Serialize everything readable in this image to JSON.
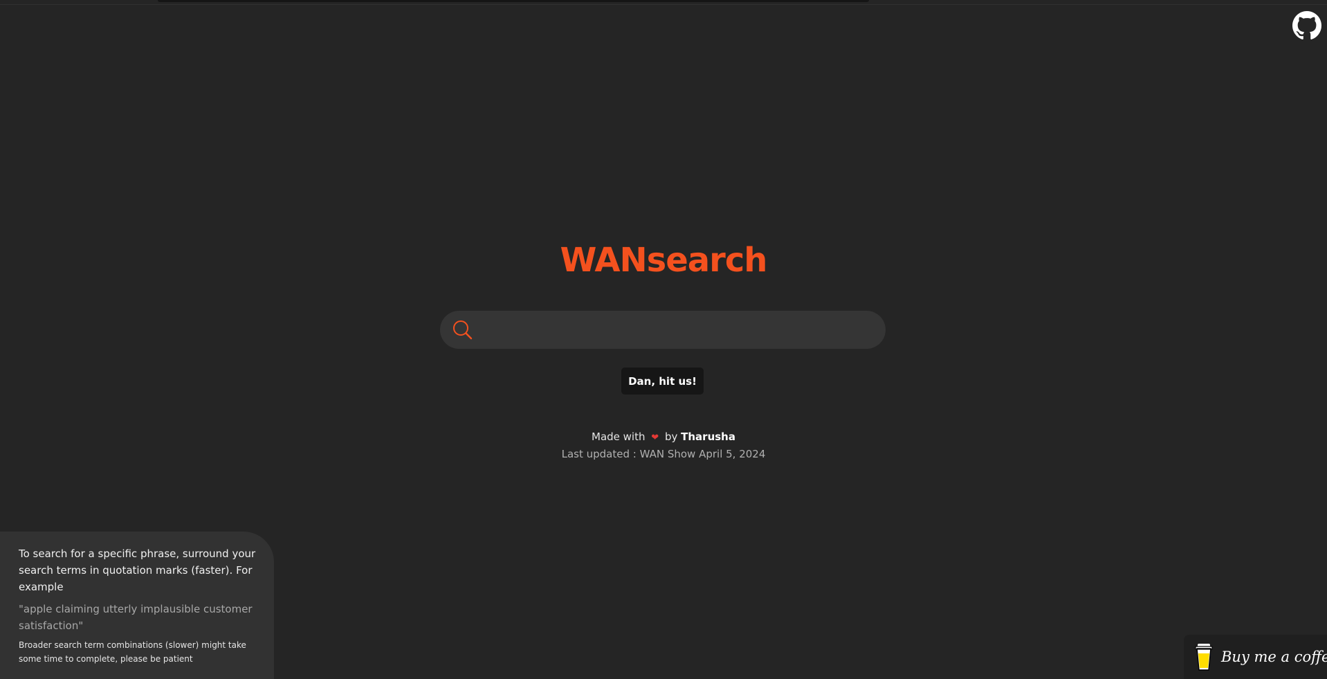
{
  "header": {
    "github_icon": "github-icon"
  },
  "main": {
    "title": "WANsearch",
    "search": {
      "icon": "search-icon",
      "value": "",
      "placeholder": ""
    },
    "random_button_label": "Dan, hit us!",
    "credits": {
      "made_with": "Made with",
      "heart_icon": "heart-icon",
      "by": "by",
      "author": "Tharusha",
      "last_updated": "Last updated : WAN Show April 5, 2024"
    }
  },
  "tips": {
    "main": "To search for a specific phrase, surround your search terms in quotation marks (faster). For example",
    "example": "\"apple claiming utterly implausible customer satisfaction\"",
    "note": "Broader search term combinations (slower) might take some time to complete, please be patient"
  },
  "coffee": {
    "label": "Buy me a coffee",
    "icon": "coffee-cup-icon"
  },
  "colors": {
    "background": "#252525",
    "accent": "#f4511e",
    "search_bg": "#353535",
    "panel_bg": "#323232",
    "button_bg": "#161616",
    "heart": "#e53935"
  }
}
